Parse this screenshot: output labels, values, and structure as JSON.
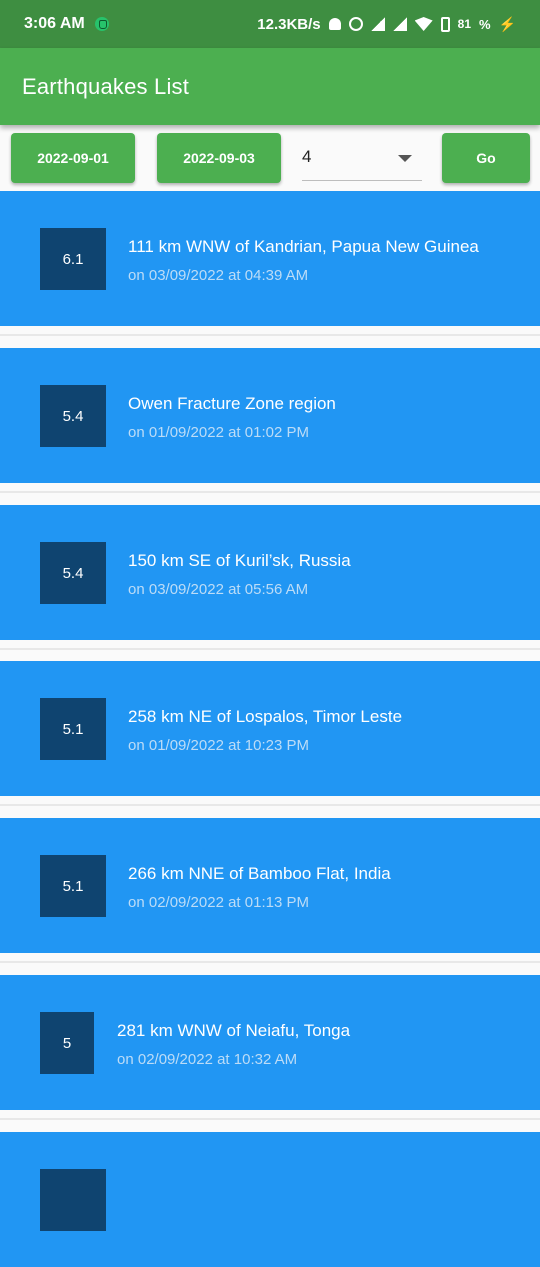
{
  "status_bar": {
    "time": "3:06 AM",
    "speed": "12.3KB/s",
    "battery": "81",
    "battery_unit": "%"
  },
  "app_bar": {
    "title": "Earthquakes List"
  },
  "controls": {
    "start_date": "2022-09-01",
    "end_date": "2022-09-03",
    "min_magnitude": "4",
    "go_label": "Go"
  },
  "colors": {
    "status_bar": "#3e8e41",
    "app_bar": "#4caf50",
    "card": "#2196f3",
    "magnitude_box": "#0f4470"
  },
  "earthquakes": [
    {
      "magnitude": "6.1",
      "place": "111 km WNW of Kandrian, Papua New Guinea",
      "time": "on 03/09/2022 at 04:39 AM"
    },
    {
      "magnitude": "5.4",
      "place": "Owen Fracture Zone region",
      "time": "on 01/09/2022 at 01:02 PM"
    },
    {
      "magnitude": "5.4",
      "place": "150 km SE of Kuril’sk, Russia",
      "time": "on 03/09/2022 at 05:56 AM"
    },
    {
      "magnitude": "5.1",
      "place": "258 km NE of Lospalos, Timor Leste",
      "time": "on 01/09/2022 at 10:23 PM"
    },
    {
      "magnitude": "5.1",
      "place": "266 km NNE of Bamboo Flat, India",
      "time": "on 02/09/2022 at 01:13 PM"
    },
    {
      "magnitude": "5",
      "place": "281 km WNW of Neiafu, Tonga",
      "time": "on 02/09/2022 at 10:32 AM"
    }
  ]
}
